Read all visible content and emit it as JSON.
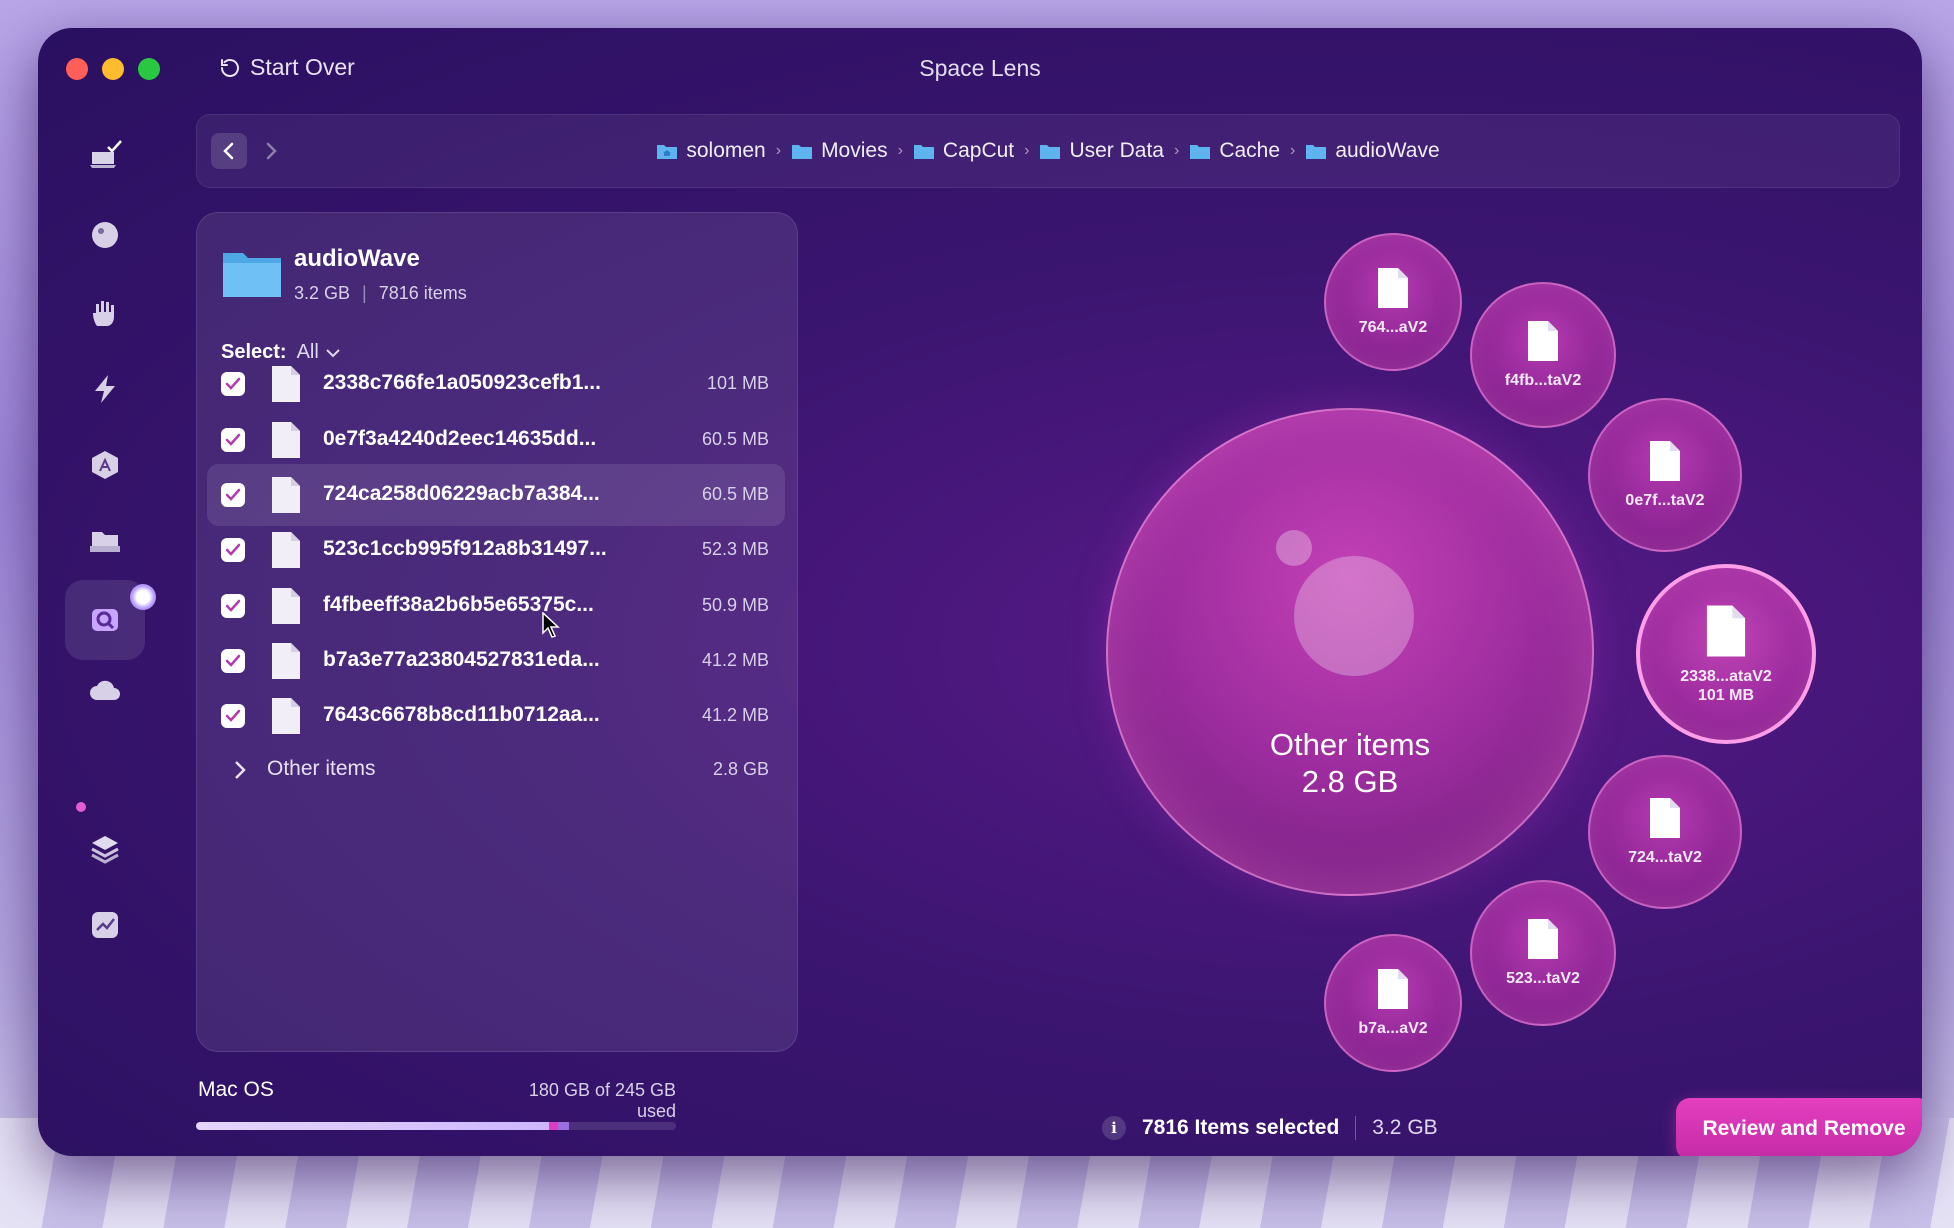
{
  "window": {
    "title": "Space Lens",
    "start_over_label": "Start Over"
  },
  "sidebar": {
    "items": [
      {
        "icon": "monitor-check-icon"
      },
      {
        "icon": "protection-icon"
      },
      {
        "icon": "hand-privacy-icon"
      },
      {
        "icon": "lightning-speed-icon"
      },
      {
        "icon": "applications-icon"
      },
      {
        "icon": "folder-tray-icon"
      },
      {
        "icon": "space-lens-icon",
        "active": true
      },
      {
        "icon": "cloud-icon"
      },
      {
        "icon": "stack-layers-icon"
      },
      {
        "icon": "chart-icon"
      }
    ]
  },
  "breadcrumb": [
    "solomen",
    "Movies",
    "CapCut",
    "User Data",
    "Cache",
    "audioWave"
  ],
  "folder": {
    "name": "audioWave",
    "size": "3.2 GB",
    "items": "7816 items"
  },
  "select": {
    "label": "Select:",
    "value": "All"
  },
  "files": [
    {
      "name": "2338c766fe1a050923cefb1...",
      "size": "101 MB",
      "checked": true
    },
    {
      "name": "0e7f3a4240d2eec14635dd...",
      "size": "60.5 MB",
      "checked": true
    },
    {
      "name": "724ca258d06229acb7a384...",
      "size": "60.5 MB",
      "checked": true
    },
    {
      "name": "523c1ccb995f912a8b31497...",
      "size": "52.3 MB",
      "checked": true
    },
    {
      "name": "f4fbeeff38a2b6b5e65375c...",
      "size": "50.9 MB",
      "checked": true
    },
    {
      "name": "b7a3e77a23804527831eda...",
      "size": "41.2 MB",
      "checked": true
    },
    {
      "name": "7643c6678b8cd11b0712aa...",
      "size": "41.2 MB",
      "checked": true
    }
  ],
  "other_items": {
    "label": "Other items",
    "size": "2.8 GB"
  },
  "disk": {
    "name": "Mac OS",
    "used_text": "180 GB of 245 GB used",
    "used_fraction": 0.735,
    "selected_gb": 3.2,
    "total_gb": 245
  },
  "bubbles": {
    "main": {
      "label": "Other items",
      "size": "2.8 GB"
    },
    "b1": {
      "label": "764...aV2"
    },
    "b2": {
      "label": "f4fb...taV2"
    },
    "b3": {
      "label": "0e7f...taV2"
    },
    "b4": {
      "label": "2338...ataV2",
      "size": "101 MB"
    },
    "b5": {
      "label": "724...taV2"
    },
    "b6": {
      "label": "523...taV2"
    },
    "b7": {
      "label": "b7a...aV2"
    }
  },
  "status": {
    "info_glyph": "i",
    "selected_text": "7816 Items selected",
    "total": "3.2 GB"
  },
  "review_button": "Review and Remove",
  "colors": {
    "accent": "#d43ab8",
    "window_bg": "#3b1570",
    "bubble": "#9b2c9d"
  }
}
